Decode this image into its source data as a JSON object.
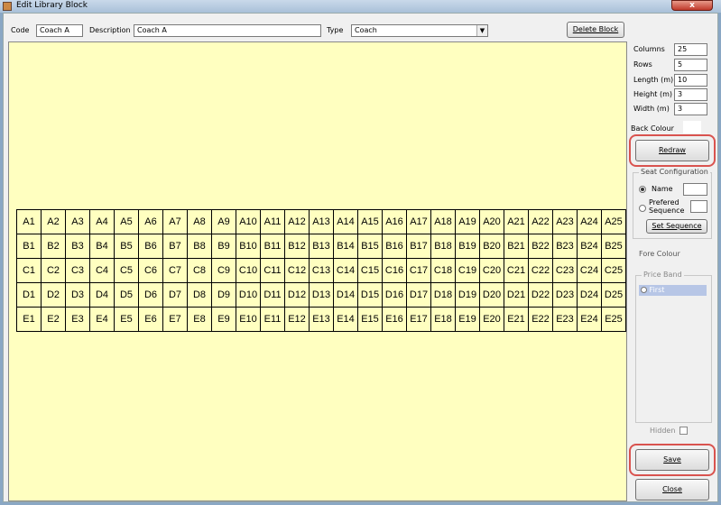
{
  "window": {
    "title": "Edit Library Block",
    "close_label": "x"
  },
  "toolbar": {
    "code_label": "Code",
    "code_value": "Coach A",
    "description_label": "Description",
    "description_value": "Coach A",
    "type_label": "Type",
    "type_value": "Coach",
    "delete_label": "Delete Block"
  },
  "grid": {
    "rows": [
      [
        "A1",
        "A2",
        "A3",
        "A4",
        "A5",
        "A6",
        "A7",
        "A8",
        "A9",
        "A10",
        "A11",
        "A12",
        "A13",
        "A14",
        "A15",
        "A16",
        "A17",
        "A18",
        "A19",
        "A20",
        "A21",
        "A22",
        "A23",
        "A24",
        "A25"
      ],
      [
        "B1",
        "B2",
        "B3",
        "B4",
        "B5",
        "B6",
        "B7",
        "B8",
        "B9",
        "B10",
        "B11",
        "B12",
        "B13",
        "B14",
        "B15",
        "B16",
        "B17",
        "B18",
        "B19",
        "B20",
        "B21",
        "B22",
        "B23",
        "B24",
        "B25"
      ],
      [
        "C1",
        "C2",
        "C3",
        "C4",
        "C5",
        "C6",
        "C7",
        "C8",
        "C9",
        "C10",
        "C11",
        "C12",
        "C13",
        "C14",
        "C15",
        "C16",
        "C17",
        "C18",
        "C19",
        "C20",
        "C21",
        "C22",
        "C23",
        "C24",
        "C25"
      ],
      [
        "D1",
        "D2",
        "D3",
        "D4",
        "D5",
        "D6",
        "D7",
        "D8",
        "D9",
        "D10",
        "D11",
        "D12",
        "D13",
        "D14",
        "D15",
        "D16",
        "D17",
        "D18",
        "D19",
        "D20",
        "D21",
        "D22",
        "D23",
        "D24",
        "D25"
      ],
      [
        "E1",
        "E2",
        "E3",
        "E4",
        "E5",
        "E6",
        "E7",
        "E8",
        "E9",
        "E10",
        "E11",
        "E12",
        "E13",
        "E14",
        "E15",
        "E16",
        "E17",
        "E18",
        "E19",
        "E20",
        "E21",
        "E22",
        "E23",
        "E24",
        "E25"
      ]
    ]
  },
  "panel": {
    "columns_label": "Columns",
    "columns_value": "25",
    "rows_label": "Rows",
    "rows_value": "5",
    "length_label": "Length (m)",
    "length_value": "10",
    "height_label": "Height (m)",
    "height_value": "3",
    "width_label": "Width (m)",
    "width_value": "3",
    "back_colour_label": "Back Colour",
    "redraw_label": "Redraw",
    "seat_config_title": "Seat Configuration",
    "name_label": "Name",
    "prefered_label_1": "Prefered",
    "prefered_label_2": "Sequence",
    "set_sequence_label": "Set Sequence",
    "fore_colour_label": "Fore Colour",
    "price_band_title": "Price Band",
    "price_band_item": "First",
    "hidden_label": "Hidden",
    "save_label": "Save",
    "close_label": "Close"
  },
  "colors": {
    "canvas_background": "#ffffc0",
    "highlight": "#d9534f",
    "selected_price_band": "#b7c6e6"
  }
}
